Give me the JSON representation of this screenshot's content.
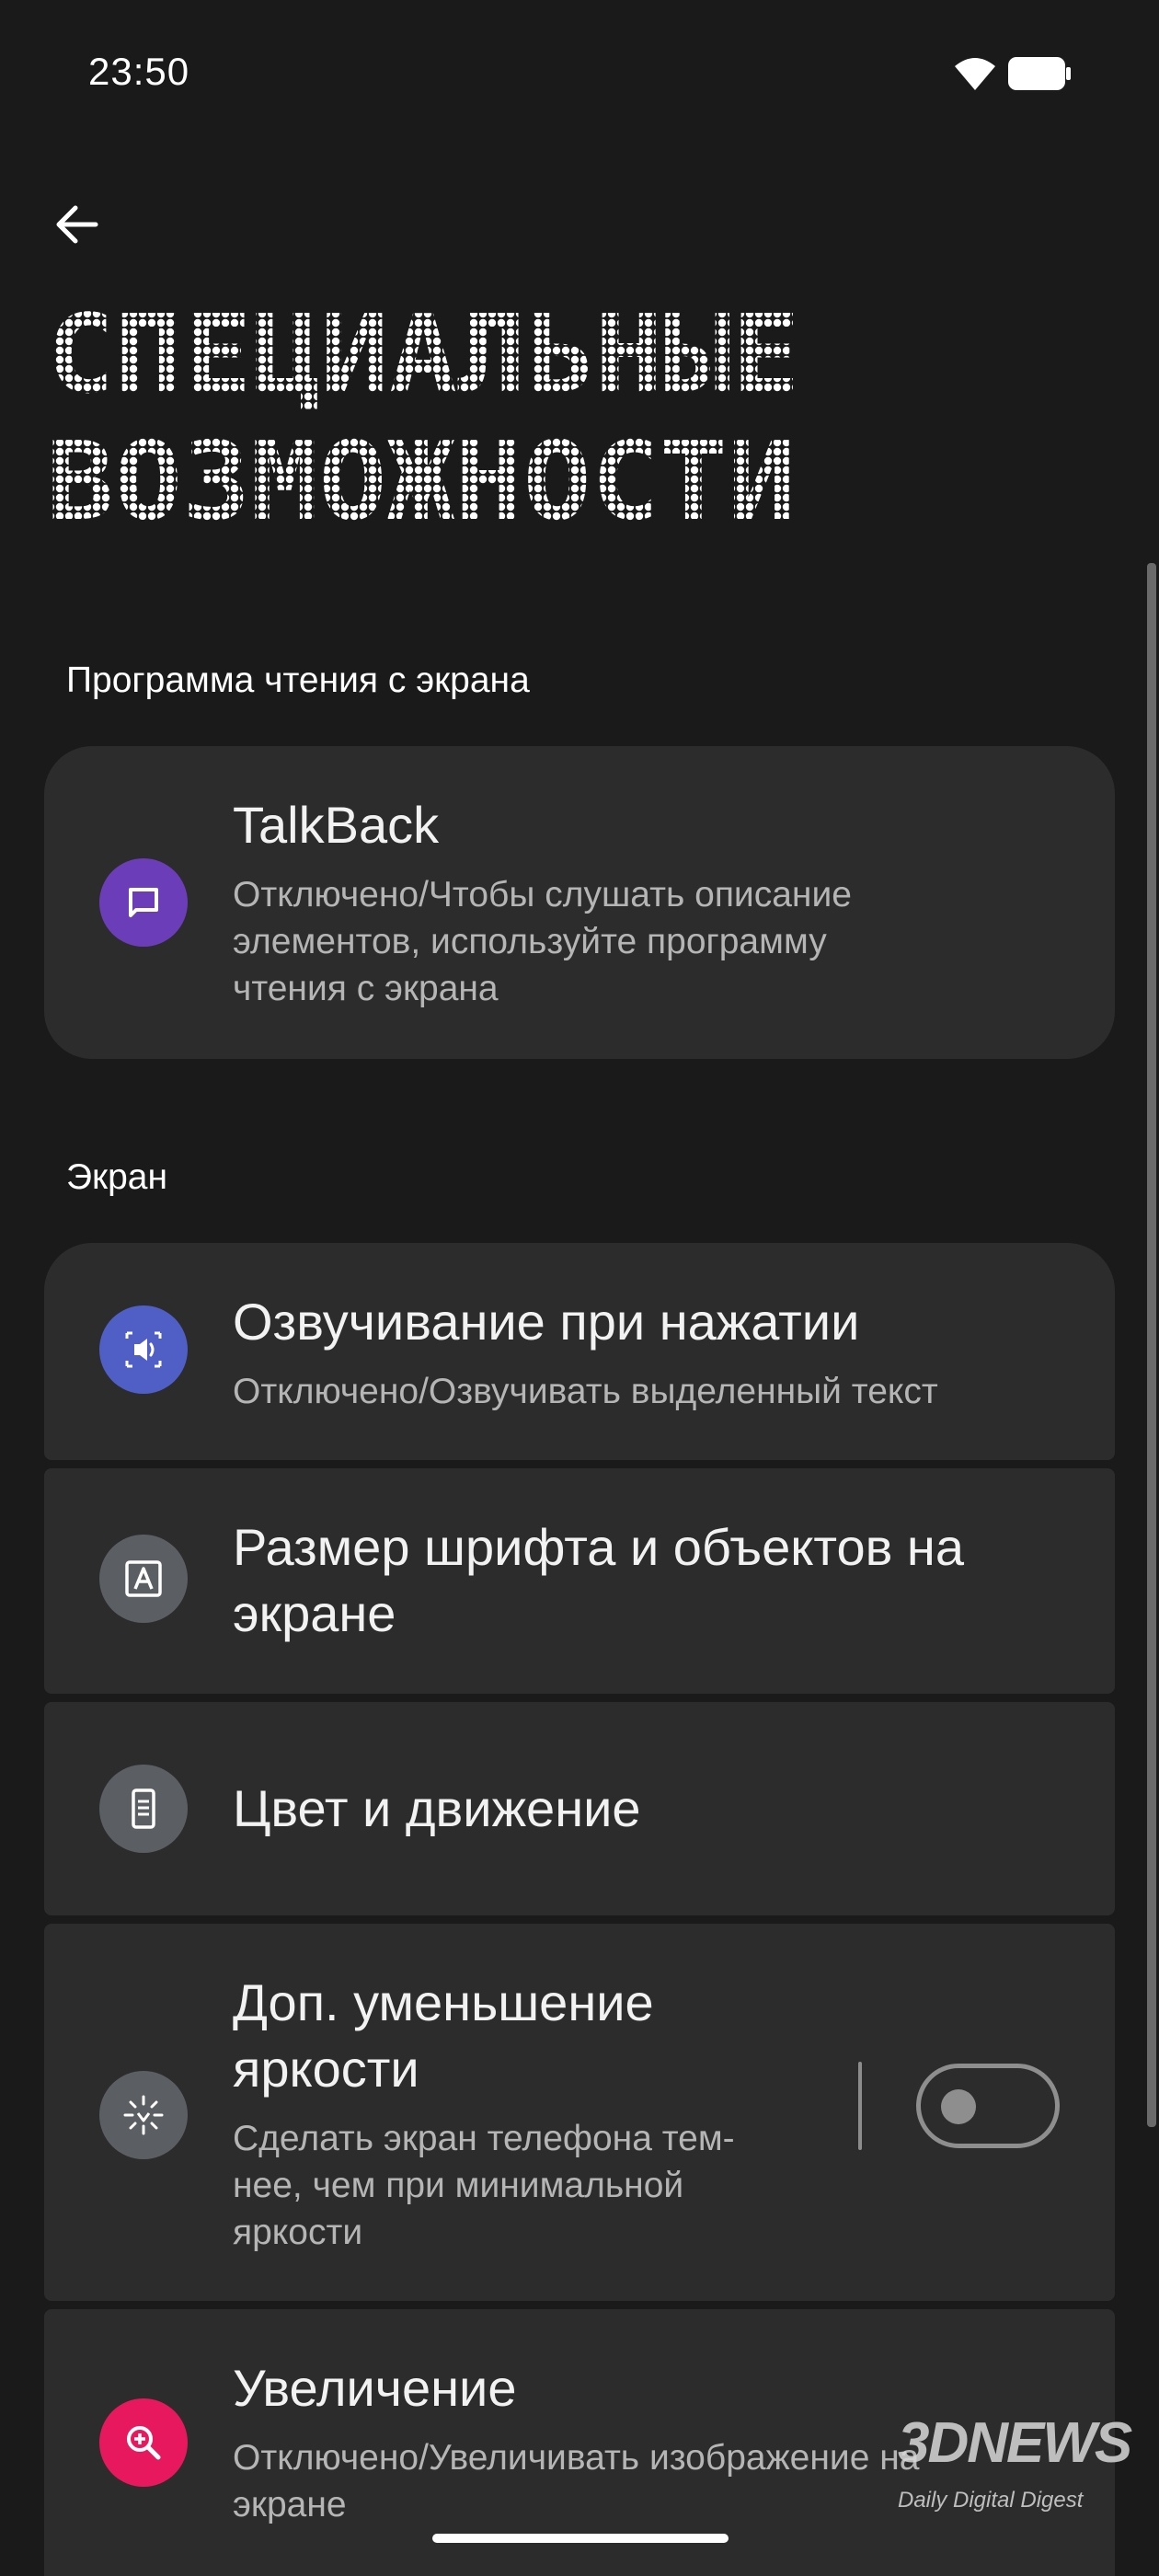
{
  "status_bar": {
    "time": "23:50"
  },
  "header": {
    "title_line1": "СПЕЦИАЛЬНЫЕ",
    "title_line2": "ВОЗМОЖНОСТИ"
  },
  "sections": {
    "screen_reader": {
      "header": "Программа чтения с экрана",
      "talkback": {
        "title": "TalkBack",
        "subtitle_line1": "Отключено/Чтобы слушать описание",
        "subtitle_line2": "элементов, используйте программу",
        "subtitle_line3": "чтения с экрана",
        "icon": "chat-bubble-icon",
        "icon_color": "#6c3db8"
      }
    },
    "screen": {
      "header": "Экран",
      "select_to_speak": {
        "title": "Озвучивание при нажатии",
        "subtitle": "Отключено/Озвучивать выделенный текст",
        "icon": "speaker-select-icon",
        "icon_color": "#4f5fc5"
      },
      "font_size": {
        "title_line1": "Размер шрифта и объектов на",
        "title_line2": "экране",
        "icon": "font-size-icon",
        "icon_color": "#5b5e63"
      },
      "color_motion": {
        "title": "Цвет и движение",
        "icon": "phone-color-icon",
        "icon_color": "#5b5e63"
      },
      "extra_dim": {
        "title_line1": "Доп. уменьшение",
        "title_line2": "яркости",
        "subtitle_line1": "Сделать экран телефона тем-",
        "subtitle_line2": "нее, чем при минимальной",
        "subtitle_line3": "яркости",
        "toggle_on": false,
        "icon": "brightness-icon",
        "icon_color": "#5b5e63"
      },
      "magnification": {
        "title": "Увеличение",
        "subtitle_line1": "Отключено/Увеличивать изображение на",
        "subtitle_line2": "экране",
        "icon": "zoom-in-icon",
        "icon_color": "#e8185f"
      }
    }
  },
  "watermark": {
    "brand": "3DNEWS",
    "tagline": "Daily Digital Digest"
  }
}
